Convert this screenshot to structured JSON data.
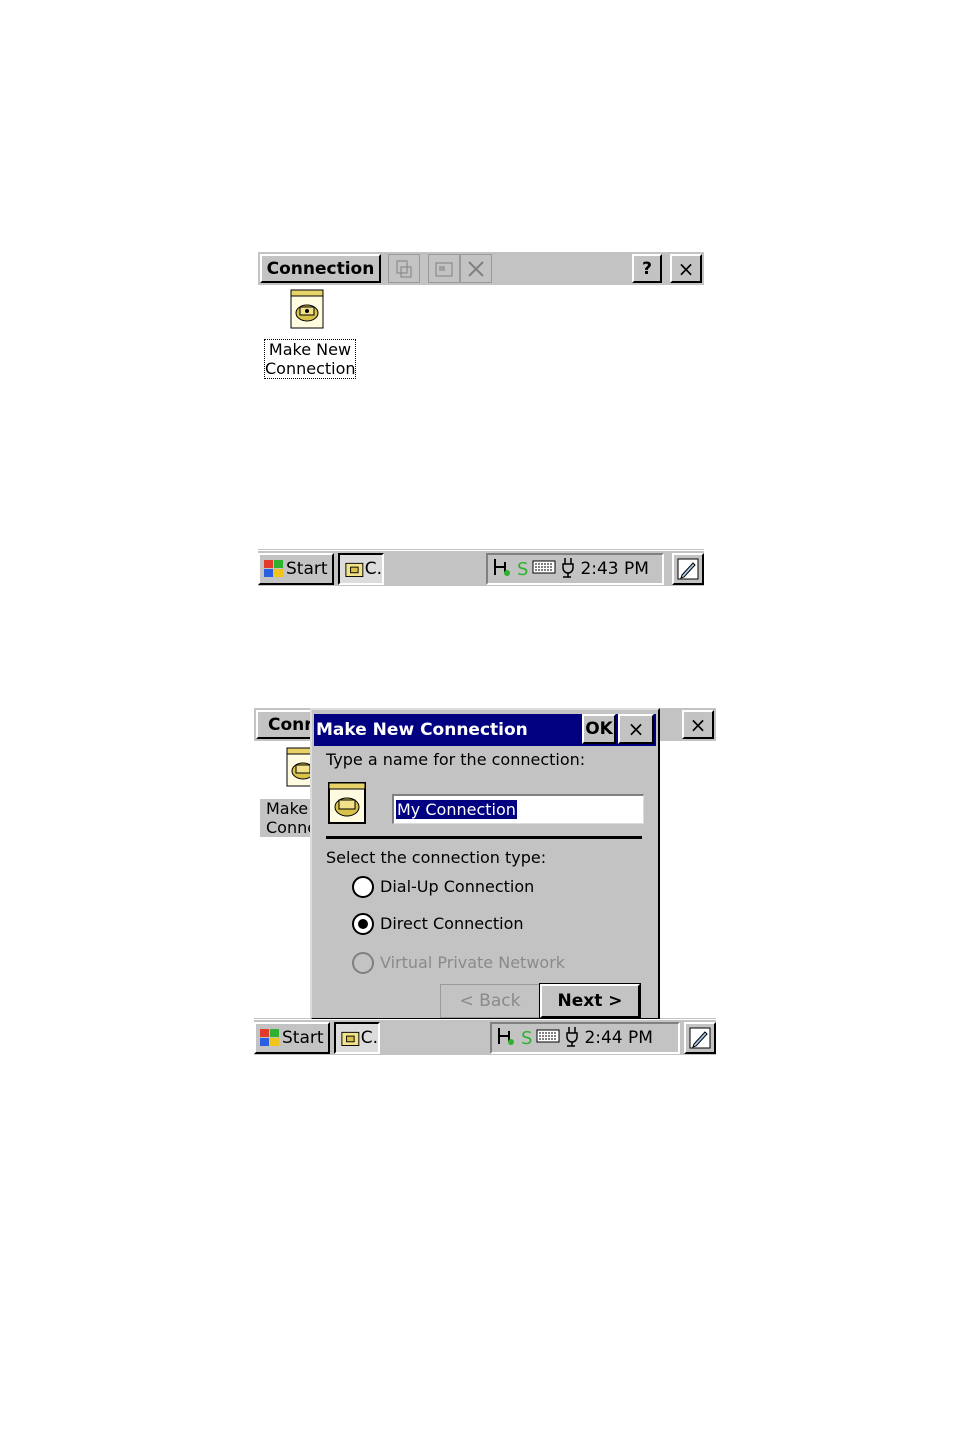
{
  "screen1": {
    "app_title": "Connection",
    "help_label": "?",
    "close_label": "×",
    "desktop_icon_label_line1": "Make New",
    "desktop_icon_label_line2": "Connection",
    "taskbar": {
      "start_label": "Start",
      "task_label": "C.",
      "clock": "2:43 PM",
      "tray_s": "S"
    }
  },
  "screen2": {
    "app_title_partial": "Conr",
    "close_label": "×",
    "desktop_icon_label_line1": "Make",
    "desktop_icon_label_line2": "Conne",
    "dialog": {
      "title": "Make New Connection",
      "ok_label": "OK",
      "close_label": "×",
      "name_prompt": "Type a name for the connection:",
      "name_value": "My Connection",
      "type_prompt": "Select the connection type:",
      "options": [
        {
          "label": "Dial-Up Connection",
          "selected": false,
          "enabled": true
        },
        {
          "label": "Direct Connection",
          "selected": true,
          "enabled": true
        },
        {
          "label": "Virtual Private Network",
          "selected": false,
          "enabled": false
        }
      ],
      "back_label": "< Back",
      "next_label": "Next >"
    },
    "taskbar": {
      "start_label": "Start",
      "task_label": "C.",
      "clock": "2:44 PM",
      "tray_s": "S"
    }
  },
  "icons": [
    "windows-flag-icon",
    "phone-folder-icon",
    "network-icon",
    "keyboard-icon",
    "power-plug-icon",
    "pen-icon",
    "connect-icon",
    "properties-icon",
    "delete-icon"
  ]
}
